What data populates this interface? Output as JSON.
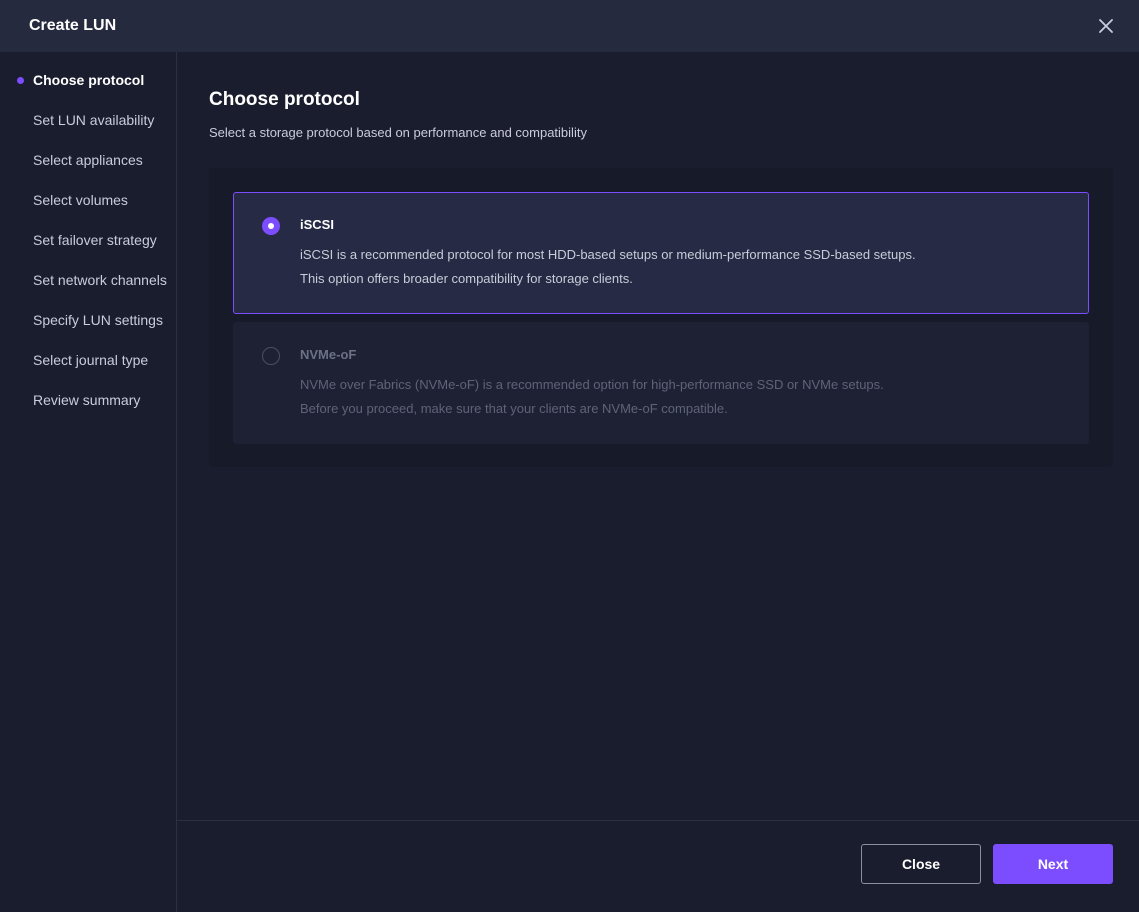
{
  "window": {
    "title": "Create LUN",
    "close_icon": "close-icon"
  },
  "sidebar": {
    "steps": [
      {
        "label": "Choose protocol",
        "active": true
      },
      {
        "label": "Set LUN availability",
        "active": false
      },
      {
        "label": "Select appliances",
        "active": false
      },
      {
        "label": "Select volumes",
        "active": false
      },
      {
        "label": "Set failover strategy",
        "active": false
      },
      {
        "label": "Set network channels",
        "active": false
      },
      {
        "label": "Specify LUN settings",
        "active": false
      },
      {
        "label": "Select journal type",
        "active": false
      },
      {
        "label": "Review summary",
        "active": false
      }
    ]
  },
  "main": {
    "heading": "Choose protocol",
    "subheading": "Select a storage protocol based on performance and compatibility",
    "options": [
      {
        "title": "iSCSI",
        "selected": true,
        "enabled": true,
        "desc_line1": "iSCSI is a recommended protocol for most HDD-based setups or medium-performance SSD-based setups.",
        "desc_line2": "This option offers broader compatibility for storage clients."
      },
      {
        "title": "NVMe-oF",
        "selected": false,
        "enabled": false,
        "desc_line1": "NVMe over Fabrics (NVMe-oF) is a recommended option for high-performance SSD or NVMe setups.",
        "desc_line2": "Before you proceed, make sure that your clients are NVMe-oF compatible."
      }
    ]
  },
  "footer": {
    "close_label": "Close",
    "next_label": "Next"
  },
  "colors": {
    "accent": "#7b4dff",
    "background": "#1a1d2e",
    "titlebar": "#252a3f"
  }
}
